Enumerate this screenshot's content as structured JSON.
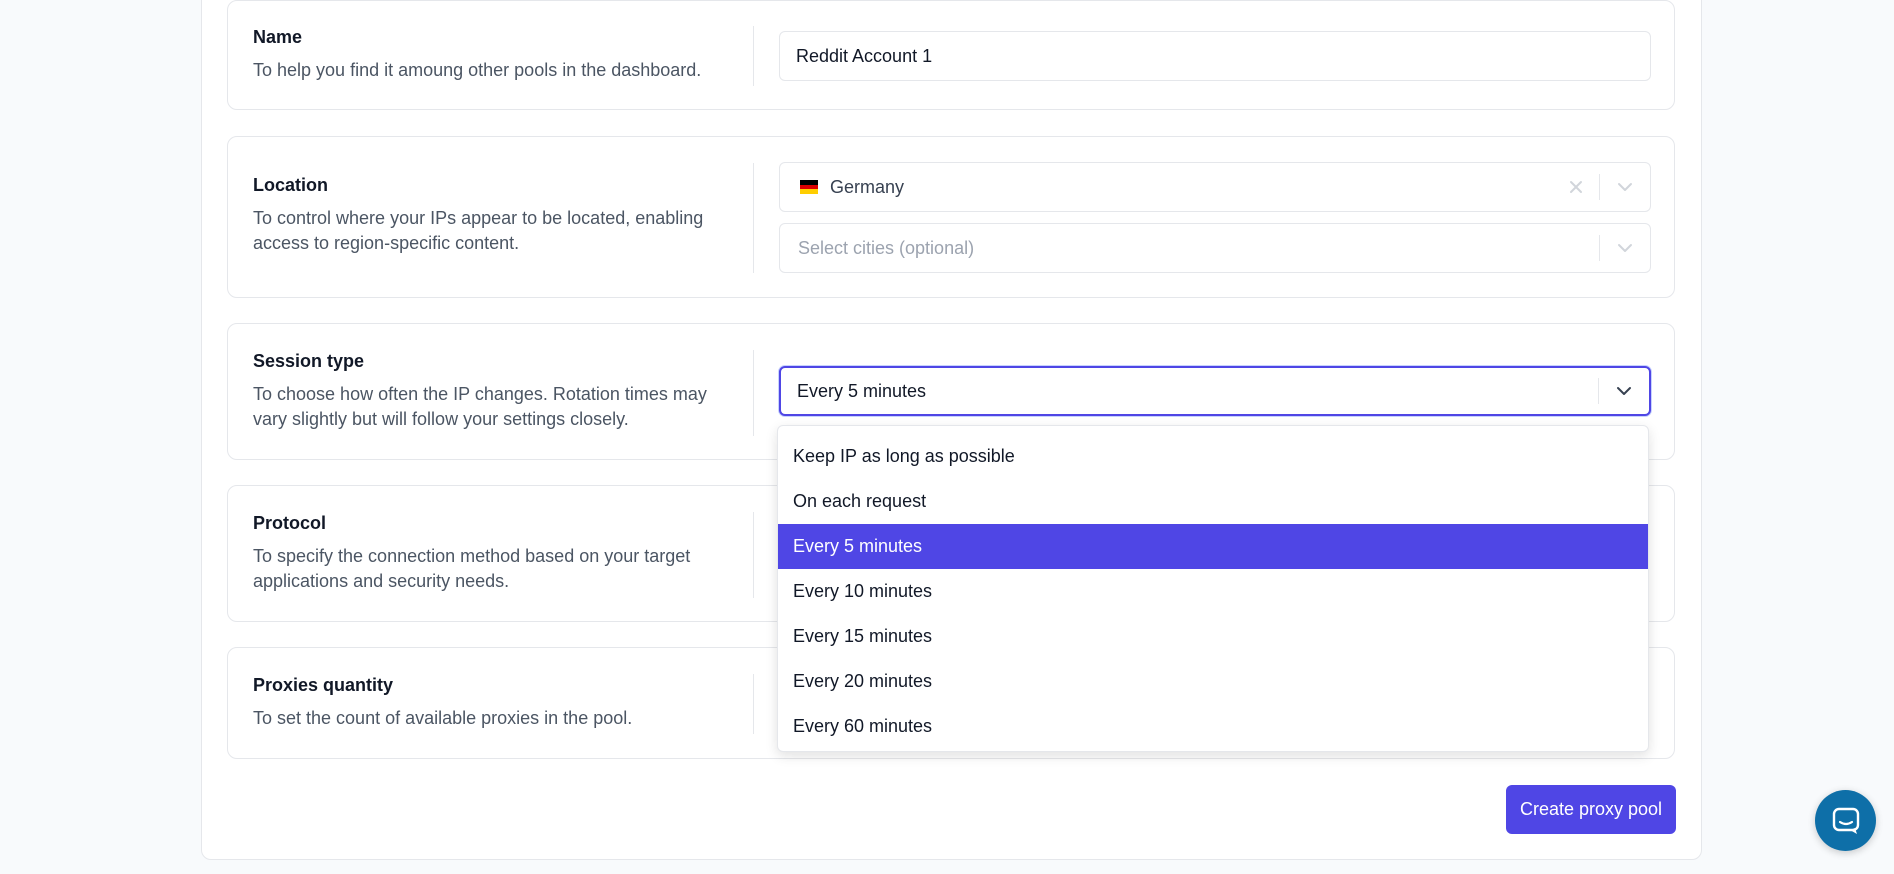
{
  "sections": {
    "name": {
      "title": "Name",
      "description": "To help you find it amoung other pools in the dashboard.",
      "value": "Reddit Account 1"
    },
    "location": {
      "title": "Location",
      "description": "To control where your IPs appear to be located, enabling access to region-specific content.",
      "country": "Germany",
      "cities_placeholder": "Select cities (optional)"
    },
    "session_type": {
      "title": "Session type",
      "description": "To choose how often the IP changes. Rotation times may vary slightly but will follow your settings closely.",
      "value": "Every 5 minutes"
    },
    "protocol": {
      "title": "Protocol",
      "description": "To specify the connection method based on your target applications and security needs."
    },
    "proxies_quantity": {
      "title": "Proxies quantity",
      "description": "To set the count of available proxies in the pool."
    }
  },
  "session_options": [
    "Keep IP as long as possible",
    "On each request",
    "Every 5 minutes",
    "Every 10 minutes",
    "Every 15 minutes",
    "Every 20 minutes",
    "Every 60 minutes"
  ],
  "selected_option": "Every 5 minutes",
  "create_button": "Create proxy pool",
  "colors": {
    "accent": "#4f46e5",
    "chat": "#0e6fa8",
    "border": "#e5e7eb",
    "background": "#f8fafc"
  },
  "icons": {
    "clear": "close-icon",
    "dropdown": "chevron-down-icon",
    "chat": "chat-icon",
    "country_flag": "germany-flag-icon"
  }
}
